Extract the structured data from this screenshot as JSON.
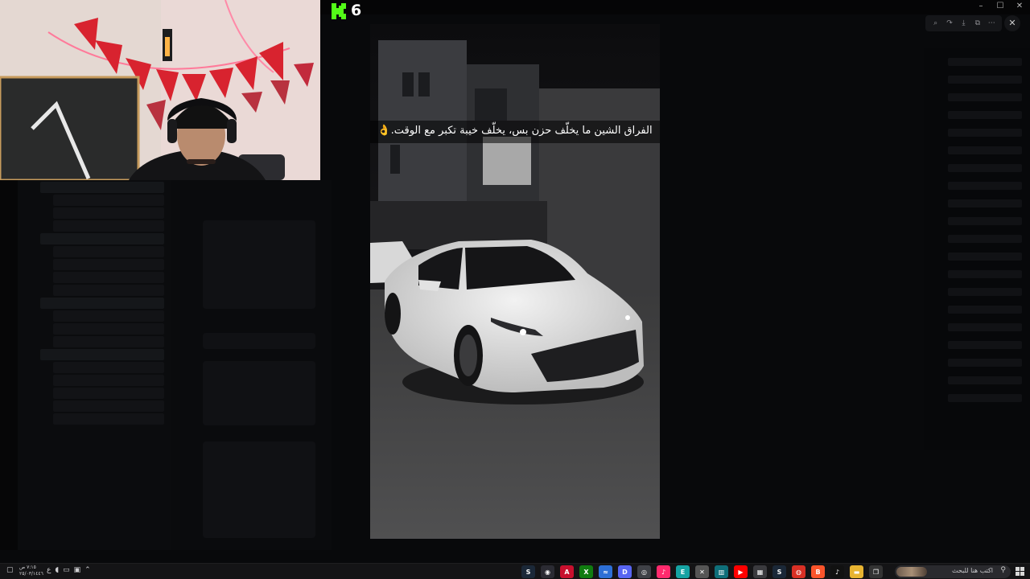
{
  "window": {
    "minimize": "–",
    "maximize": "☐",
    "close": "✕"
  },
  "viewer": {
    "tools": [
      "zoom-icon",
      "forward-icon",
      "download-icon",
      "open-external-icon",
      "more-icon"
    ],
    "tool_glyphs": [
      "⌕",
      "↷",
      "⤓",
      "⧉",
      "⋯"
    ],
    "close_glyph": "✕",
    "caption": "الفراق الشين ما يخلّف حزن بس، يخلّف خيبة تكبر مع الوقت.👌"
  },
  "stream": {
    "kick_viewer_count": "6"
  },
  "taskbar": {
    "clock_time": "٧:١٥ ص",
    "clock_date": "٢٥/٠٣/١٤٤٦",
    "lang_indicator": "ع",
    "search_placeholder": "اكتب هنا للبحث",
    "apps": [
      {
        "name": "steam-icon",
        "glyph": "S",
        "color": "#1b2838"
      },
      {
        "name": "obs-icon",
        "glyph": "◉",
        "color": "#2b2b33"
      },
      {
        "name": "adobe-icon",
        "glyph": "A",
        "color": "#c8102e"
      },
      {
        "name": "xbox-icon",
        "glyph": "X",
        "color": "#107c10"
      },
      {
        "name": "feather-icon",
        "glyph": "≈",
        "color": "#2d6fd6"
      },
      {
        "name": "discord-icon",
        "glyph": "D",
        "color": "#5865f2"
      },
      {
        "name": "chatgpt-icon",
        "glyph": "◎",
        "color": "#3f4147"
      },
      {
        "name": "tiktok-studio-icon",
        "glyph": "♪",
        "color": "#ff2a6d"
      },
      {
        "name": "elgato-icon",
        "glyph": "E",
        "color": "#16a3a3"
      },
      {
        "name": "capcut-icon",
        "glyph": "✕",
        "color": "#555"
      },
      {
        "name": "app-teal-icon",
        "glyph": "▥",
        "color": "#0f6f7a"
      },
      {
        "name": "youtube-icon",
        "glyph": "▶",
        "color": "#ff0000"
      },
      {
        "name": "calculator-icon",
        "glyph": "▦",
        "color": "#3a3a3e"
      },
      {
        "name": "steam-2-icon",
        "glyph": "S",
        "color": "#1b2838"
      },
      {
        "name": "chrome-icon",
        "glyph": "◍",
        "color": "#d93025"
      },
      {
        "name": "brave-icon",
        "glyph": "B",
        "color": "#fb542b"
      },
      {
        "name": "tiktok-icon",
        "glyph": "♪",
        "color": "#111"
      },
      {
        "name": "file-explorer-icon",
        "glyph": "▬",
        "color": "#e8b431"
      },
      {
        "name": "task-view-icon",
        "glyph": "❐",
        "color": "#333"
      }
    ]
  }
}
